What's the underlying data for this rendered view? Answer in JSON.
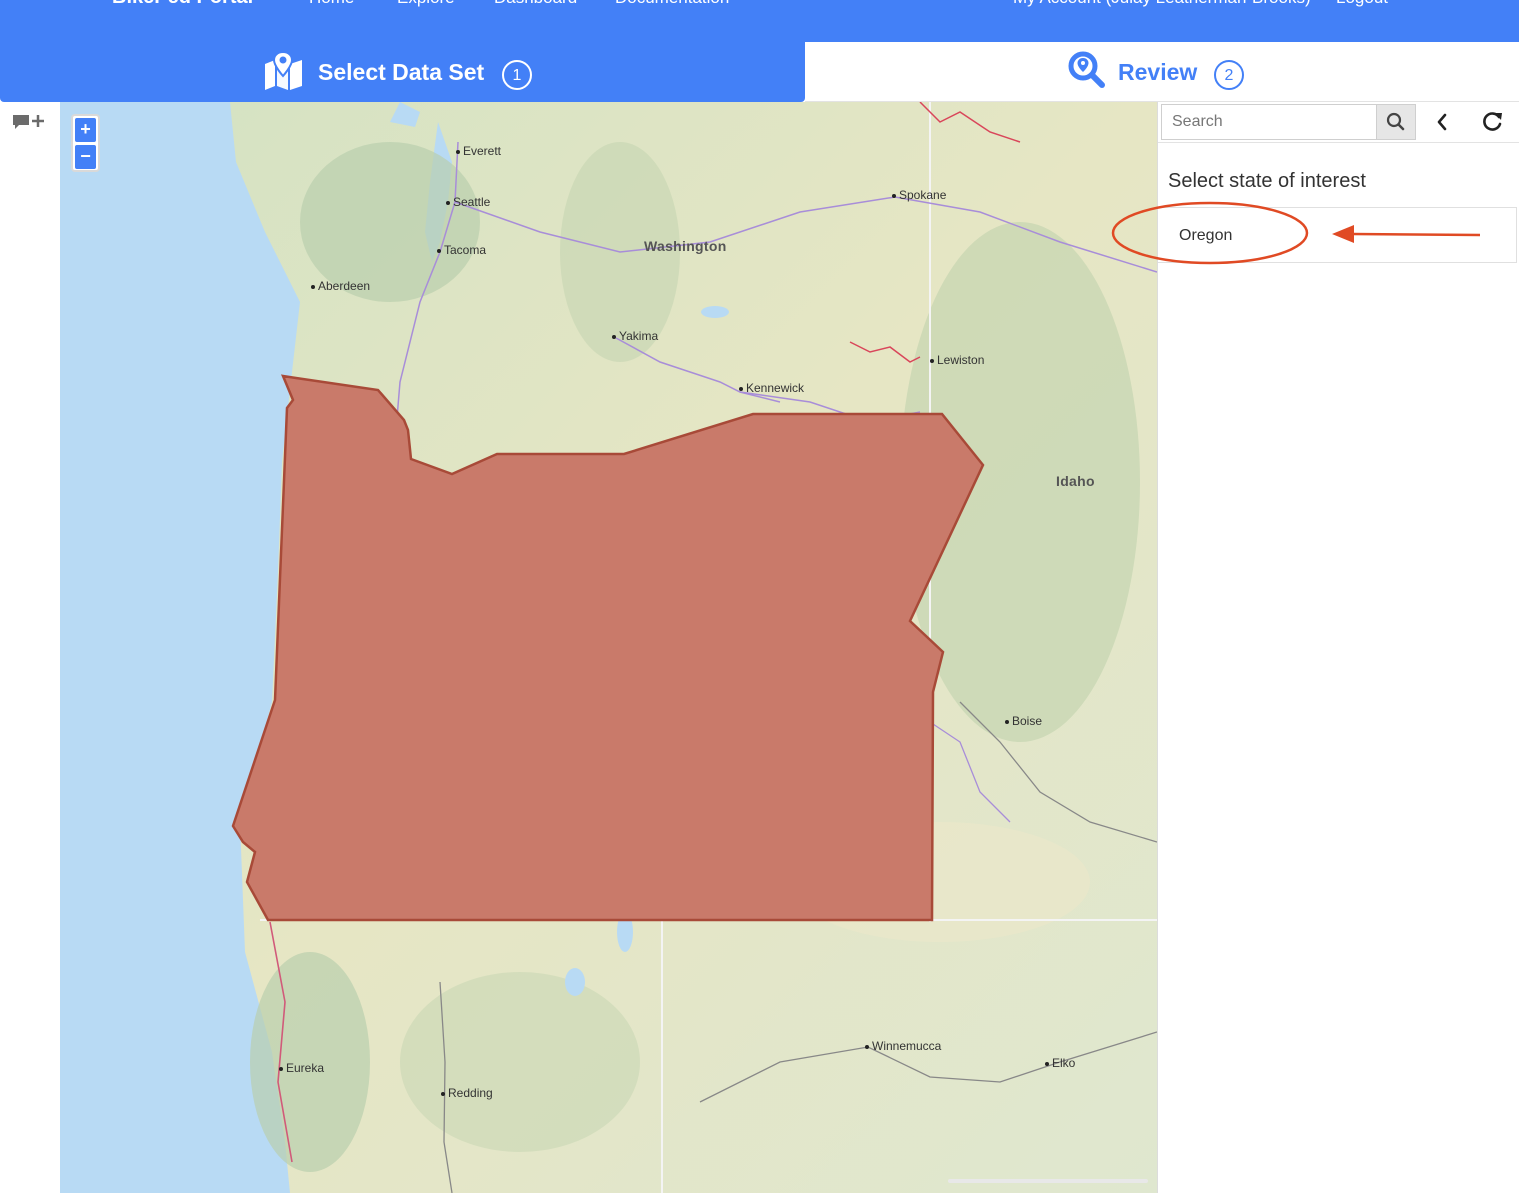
{
  "navbar": {
    "brand": "BikePed Portal",
    "links": [
      "Home",
      "Explore",
      "Dashboard",
      "Documentation"
    ],
    "account": "My Account (Julay Leatherman-Brooks)",
    "logout": "Logout"
  },
  "steps": [
    {
      "label": "Select Data Set",
      "number": "1",
      "icon": "map-icon"
    },
    {
      "label": "Review",
      "number": "2",
      "icon": "search-location-icon"
    }
  ],
  "map": {
    "zoom_in": "+",
    "zoom_out": "−",
    "state_labels": [
      "Washington",
      "Idaho"
    ],
    "cities": [
      "Everett",
      "Seattle",
      "Tacoma",
      "Aberdeen",
      "Spokane",
      "Yakima",
      "Kennewick",
      "Lewiston",
      "Boise",
      "Eureka",
      "Redding",
      "Winnemucca",
      "Elko"
    ],
    "selected_region": "Oregon",
    "highlight_color": "#c97a6a"
  },
  "panel": {
    "search_placeholder": "Search",
    "heading": "Select state of interest",
    "items": [
      "Oregon"
    ],
    "annotation_color": "#e04a24"
  }
}
